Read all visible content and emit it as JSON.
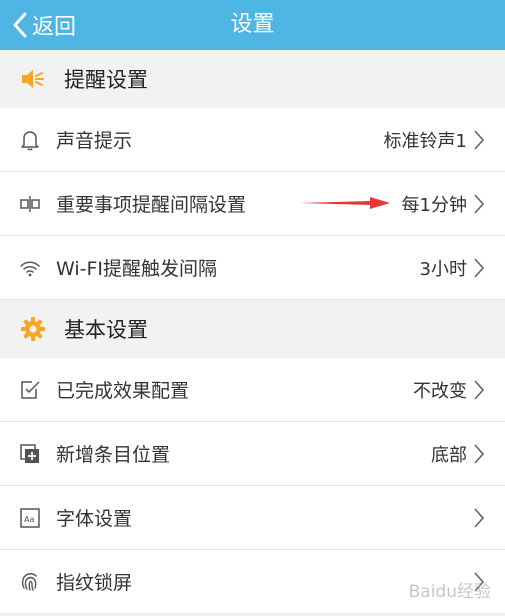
{
  "header": {
    "back_label": "返回",
    "title": "设置"
  },
  "sections": [
    {
      "label": "提醒设置",
      "icon": "speaker-icon",
      "rows": [
        {
          "label": "声音提示",
          "value": "标准铃声1",
          "icon": "bell-icon"
        },
        {
          "label": "重要事项提醒间隔设置",
          "value": "每1分钟",
          "icon": "interval-icon"
        },
        {
          "label": "Wi-FI提醒触发间隔",
          "value": "3小时",
          "icon": "wifi-icon"
        }
      ]
    },
    {
      "label": "基本设置",
      "icon": "gear-icon",
      "rows": [
        {
          "label": "已完成效果配置",
          "value": "不改变",
          "icon": "checkbox-icon"
        },
        {
          "label": "新增条目位置",
          "value": "底部",
          "icon": "add-item-icon"
        },
        {
          "label": "字体设置",
          "value": "",
          "icon": "font-icon"
        },
        {
          "label": "指纹锁屏",
          "value": "",
          "icon": "fingerprint-icon"
        }
      ]
    }
  ],
  "watermark": "Baidu经验",
  "colors": {
    "header_bg": "#4fb5e3",
    "accent_orange": "#f5a623",
    "annotation_red": "#e53935"
  }
}
